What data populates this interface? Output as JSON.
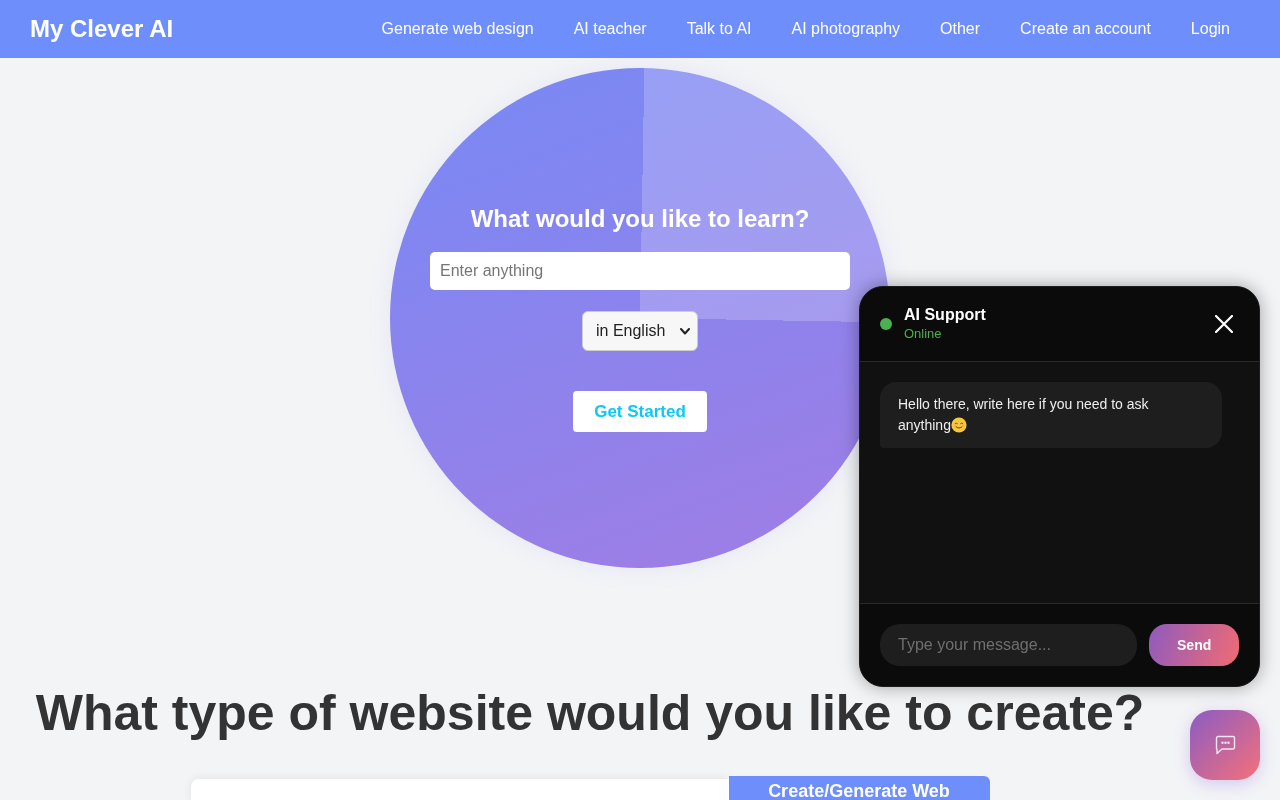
{
  "navbar": {
    "logo": "My Clever AI",
    "links": [
      "Generate web design",
      "AI teacher",
      "Talk to AI",
      "AI photography",
      "Other",
      "Create an account",
      "Login"
    ]
  },
  "hero": {
    "heading": "What would you like to learn?",
    "topic_input": {
      "placeholder": "Enter anything"
    },
    "language_select": {
      "value": "in English"
    },
    "button": "Get Started"
  },
  "website_section": {
    "heading": "What type of website would you like to create?",
    "button": "Create/Generate Web"
  },
  "chat_widget": {
    "title": "AI Support",
    "status": "Online",
    "online": true,
    "messages": [
      {
        "kind": "bot",
        "text": "Hello there, write here if you need to ask anything",
        "emoji": true
      }
    ],
    "message_input": {
      "placeholder": "Type your message..."
    },
    "send_button": "Send"
  }
}
